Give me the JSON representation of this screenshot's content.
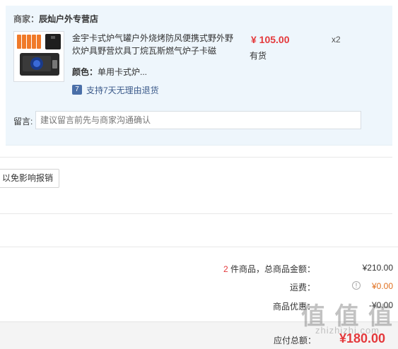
{
  "shop": {
    "label": "商家：",
    "name": "辰灿户外专营店"
  },
  "product": {
    "title": "金宇卡式炉气罐户外烧烤防风便携式野外野炊炉具野营炊具丁烷瓦斯燃气炉子卡磁",
    "attr_key": "颜色：",
    "attr_value": "单用卡式炉...",
    "price": "¥ 105.00",
    "stock": "有货",
    "qty": "x2",
    "return_policy": "支持7天无理由退货",
    "return_icon": "7"
  },
  "message": {
    "label": "留言:",
    "placeholder": "建议留言前先与商家沟通确认"
  },
  "notice_button": "以免影响报销",
  "summary": {
    "count": "2",
    "count_text": " 件商品，总商品金额：",
    "goods_total": "¥210.00",
    "freight_label": "运费：",
    "freight_value": "¥0.00",
    "discount_label": "商品优惠：",
    "discount_value": "-¥0.00",
    "total_label": "应付总额：",
    "total_value": "¥180.00"
  },
  "watermark": "值 值 值",
  "watermark_url": "zhizhizhi.com",
  "colors": {
    "price_red": "#e4393c",
    "panel_bg": "#eef6fc",
    "freight_orange": "#e4393c"
  }
}
